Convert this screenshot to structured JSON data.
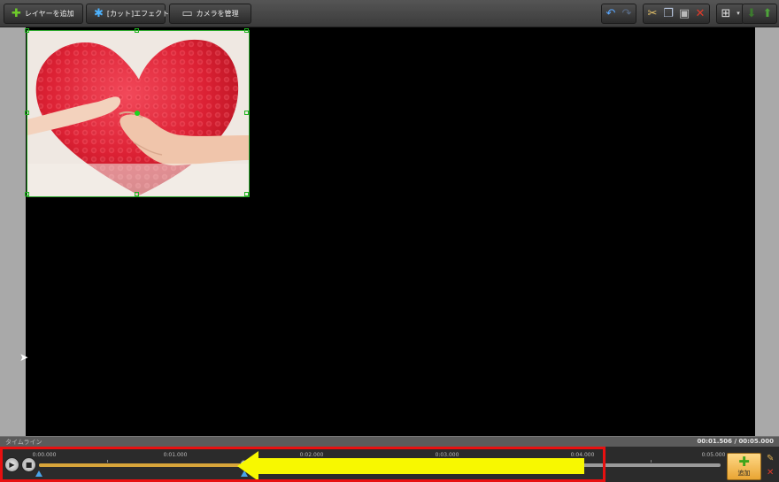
{
  "toolbar": {
    "add_layer": "レイヤーを追加",
    "cut_effect": "[カット]エフェクト",
    "camera_manage": "カメラを管理",
    "icons": {
      "add_layer": "plus-icon",
      "cut_effect": "snowflake-icon",
      "camera": "camera-icon",
      "undo": "undo-icon",
      "redo": "redo-icon",
      "cut": "scissors-icon",
      "copy": "copy-icon",
      "paste": "paste-icon",
      "delete": "delete-icon",
      "arrange": "arrange-icon",
      "move_down": "arrow-down-icon",
      "move_up": "arrow-up-icon"
    }
  },
  "canvas": {
    "background": "#000000",
    "selection_color": "#2ea82e"
  },
  "status": {
    "label": "タイムライン",
    "current_time": "00:01.506",
    "separator": "/",
    "total_time": "00:05.000"
  },
  "timeline": {
    "ticks": [
      "0:00.000",
      "0:01.000",
      "0:02.000",
      "0:03.000",
      "0:04.000",
      "0:05.000"
    ],
    "playhead_fraction": 0.301
  },
  "add_button": {
    "label": "追加"
  },
  "annotation": {
    "box_color": "#e81010",
    "arrow_color": "#f8f800"
  }
}
